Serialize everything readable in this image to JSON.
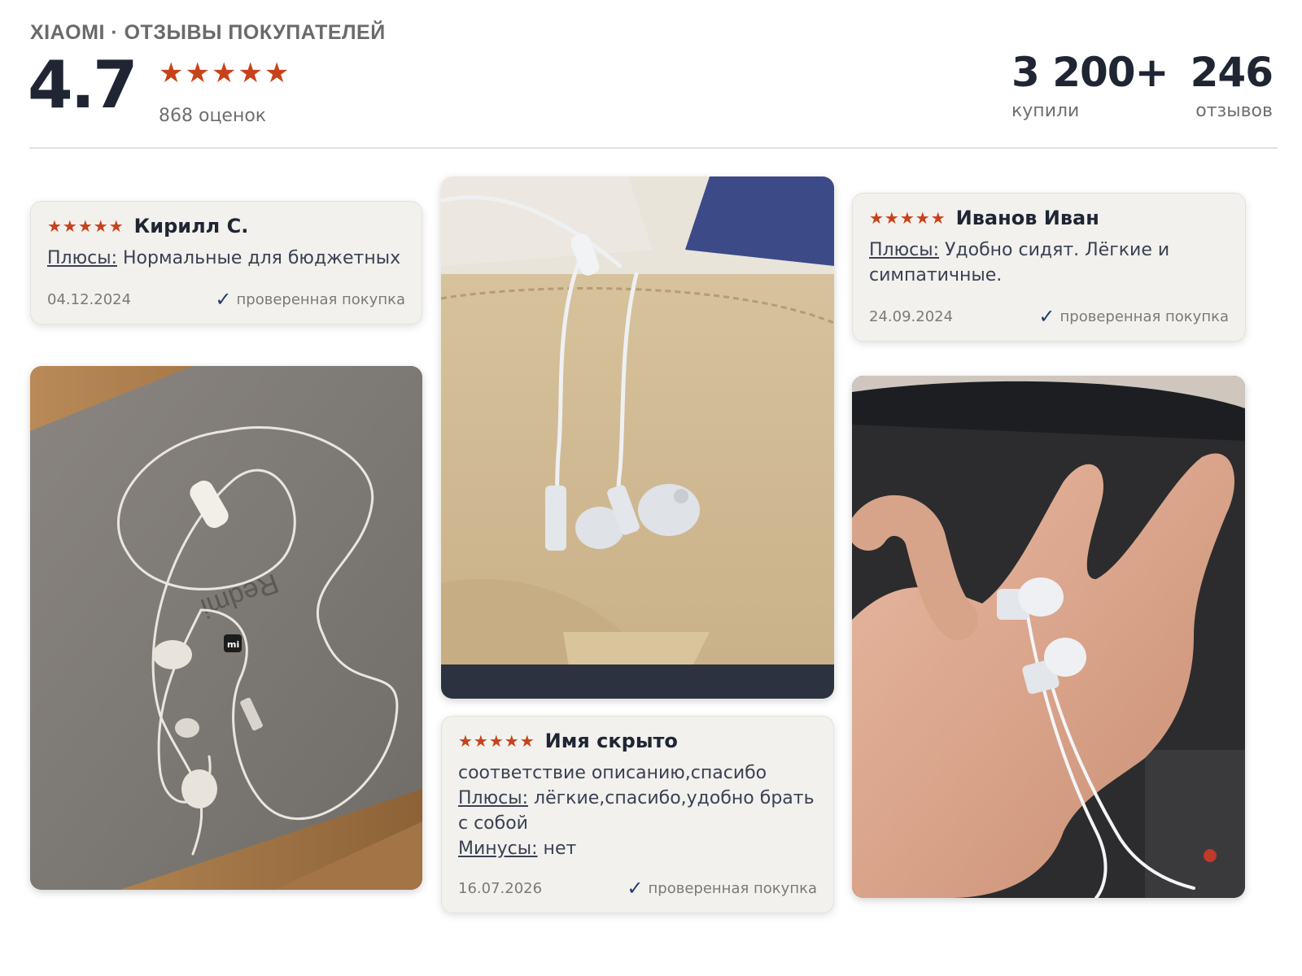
{
  "header": {
    "brand": "XIAOMI · ОТЗЫВЫ ПОКУПАТЕЛЕЙ",
    "rating": "4.7",
    "stars": "★★★★★",
    "ratings_count": "868 оценок",
    "bought_value": "3 200+",
    "bought_label": "купили",
    "reviews_value": "246",
    "reviews_label": "отзывов"
  },
  "colors": {
    "accent_star": "#c7421a",
    "check": "#243a70",
    "card_bg": "#f2f1ee",
    "text_dark": "#1f2533"
  },
  "reviews": [
    {
      "stars": "★★★★★",
      "author": "Кирилл С.",
      "pros_label": "Плюсы:",
      "pros_text": " Нормальные для бюджетных",
      "date": "04.12.2024",
      "verified_icon": "✓",
      "verified": "проверенная покупка"
    },
    {
      "stars": "★★★★★",
      "author": "Иванов Иван",
      "pros_label": "Плюсы:",
      "pros_text": " Удобно сидят. Лёгкие и симпатичные.",
      "date": "24.09.2024",
      "verified_icon": "✓",
      "verified": "проверенная покупка"
    },
    {
      "stars": "★★★★★",
      "author": "Имя скрыто",
      "comment": "соответствие описанию,спасибо",
      "pros_label": "Плюсы:",
      "pros_text": " лёгкие,спасибо,удобно брать с собой",
      "cons_label": "Минусы:",
      "cons_text": " нет",
      "date": "16.07.2026",
      "verified_icon": "✓",
      "verified": "проверенная покупка"
    }
  ],
  "photos": [
    {
      "name": "earphones-on-laptop",
      "logo": "mi"
    },
    {
      "name": "earphones-on-bag"
    },
    {
      "name": "earphones-in-hand"
    }
  ]
}
